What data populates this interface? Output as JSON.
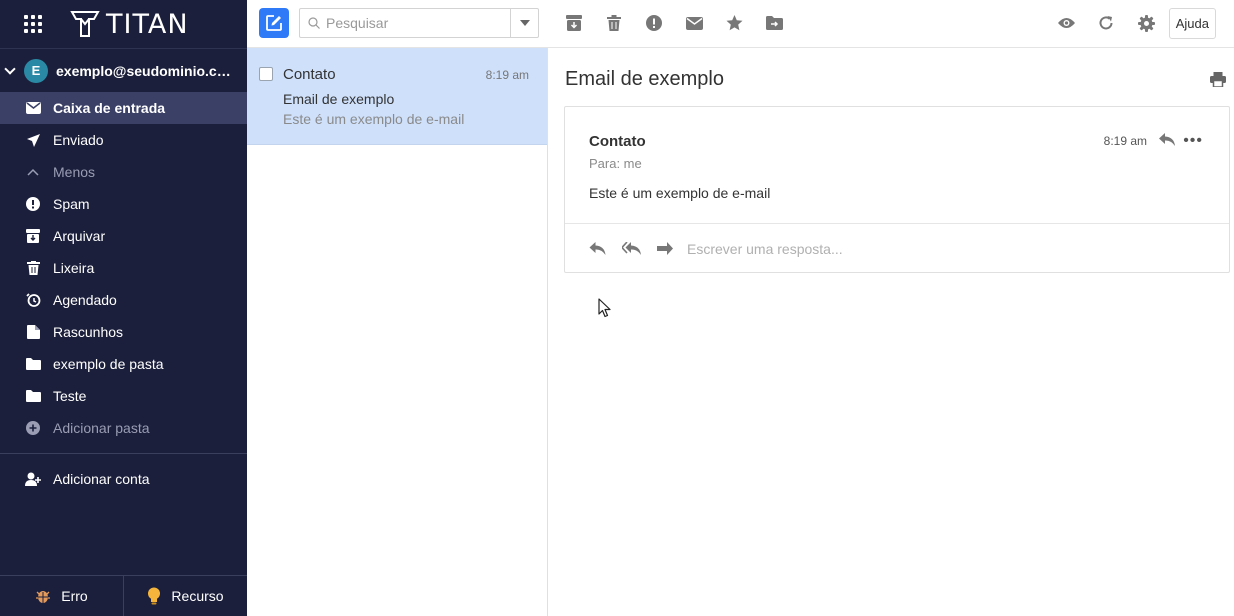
{
  "app": {
    "brand": "TITAN"
  },
  "account": {
    "initial": "E",
    "email": "exemplo@seudominio.co..."
  },
  "sidebar": {
    "items": [
      {
        "label": "Caixa de entrada",
        "icon": "inbox-icon",
        "active": true
      },
      {
        "label": "Enviado",
        "icon": "send-icon"
      },
      {
        "label": "Menos",
        "icon": "chevron-up-icon"
      },
      {
        "label": "Spam",
        "icon": "alert-icon"
      },
      {
        "label": "Arquivar",
        "icon": "archive-icon"
      },
      {
        "label": "Lixeira",
        "icon": "trash-icon"
      },
      {
        "label": "Agendado",
        "icon": "schedule-icon"
      },
      {
        "label": "Rascunhos",
        "icon": "draft-icon"
      },
      {
        "label": "exemplo de pasta",
        "icon": "folder-icon"
      },
      {
        "label": "Teste",
        "icon": "folder-icon"
      },
      {
        "label": "Adicionar pasta",
        "icon": "add-folder-icon"
      }
    ],
    "add_account": "Adicionar conta",
    "footer": {
      "bug": "Erro",
      "feature": "Recurso"
    }
  },
  "toolbar": {
    "search_placeholder": "Pesquisar",
    "help": "Ajuda"
  },
  "messages": [
    {
      "from": "Contato",
      "time": "8:19 am",
      "subject": "Email de exemplo",
      "preview": "Este é um exemplo de e-mail"
    }
  ],
  "reader": {
    "subject": "Email de exemplo",
    "from": "Contato",
    "time": "8:19 am",
    "to": "Para: me",
    "body": "Este é um exemplo de e-mail",
    "reply_placeholder": "Escrever uma resposta..."
  },
  "colors": {
    "sidebar_bg": "#1b1f3b",
    "active_item": "#3b4067",
    "accent": "#2f7af7",
    "selected_msg": "#cfe0fb"
  }
}
